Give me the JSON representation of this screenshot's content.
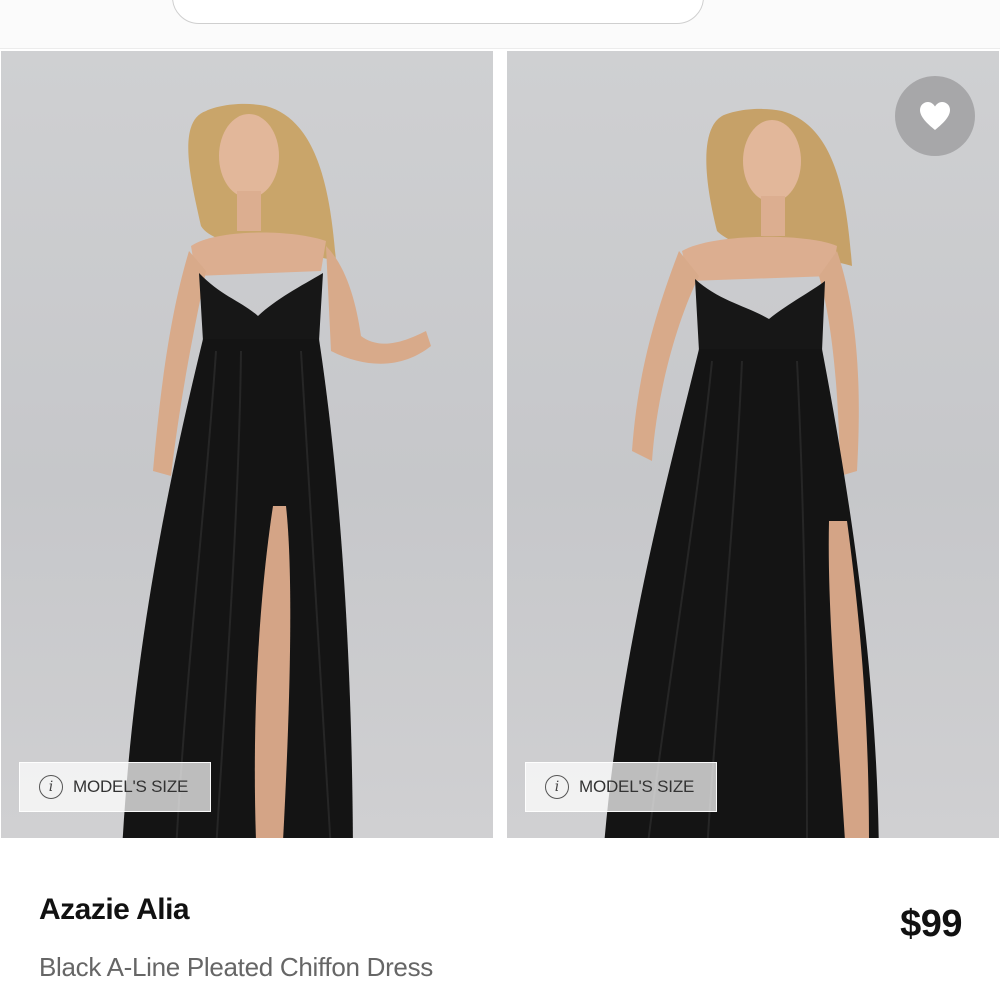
{
  "gallery": {
    "images": [
      {
        "alt": "model-front-hand-on-hip",
        "badge_label": "MODEL'S SIZE",
        "badge_icon": "info-icon"
      },
      {
        "alt": "model-front-arms-down",
        "badge_label": "MODEL'S SIZE",
        "badge_icon": "info-icon"
      }
    ],
    "favorite_icon": "heart-icon"
  },
  "product": {
    "name": "Azazie Alia",
    "description": "Black A-Line Pleated Chiffon Dress",
    "price": "$99"
  },
  "colors": {
    "dress": "#151515",
    "backdrop": "#c9cacc",
    "text_primary": "#111111",
    "text_secondary": "#666666"
  }
}
